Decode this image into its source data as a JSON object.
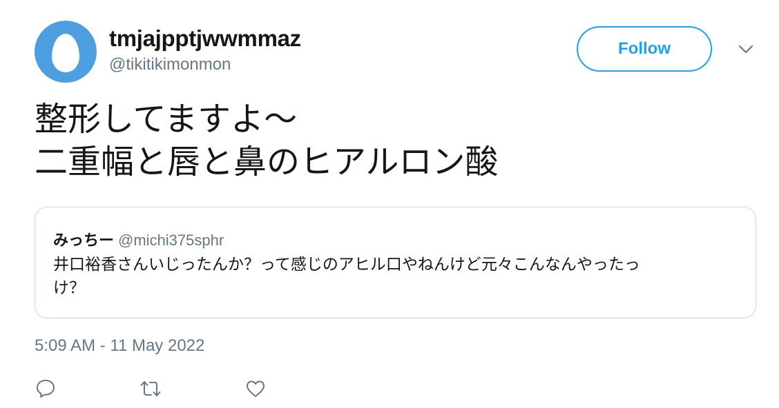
{
  "author": {
    "display_name": "tmjajpptjwwmmaz",
    "handle": "@tikitikimonmon",
    "avatar_color": "#4d9fe0"
  },
  "follow_button": {
    "label": "Follow",
    "color": "#1da1f2"
  },
  "menu": {
    "icon": "chevron-down-icon"
  },
  "tweet": {
    "lines": [
      "整形してますよ〜",
      "二重幅と唇と鼻のヒアルロン酸"
    ]
  },
  "quoted_tweet": {
    "display_name": "みっちー",
    "handle": "@michi375sphr",
    "lines": [
      "井口裕香さんいじったんか？って感じのアヒル口やねんけど元々こんなんやったっ",
      "け？"
    ]
  },
  "timestamp": "5:09 AM - 11 May 2022",
  "actions": [
    {
      "icon": "reply-icon"
    },
    {
      "icon": "retweet-icon"
    },
    {
      "icon": "like-icon"
    }
  ],
  "colors": {
    "text": "#14171a",
    "secondary": "#657786",
    "border": "#ccd6dd",
    "accent": "#1da1f2"
  }
}
